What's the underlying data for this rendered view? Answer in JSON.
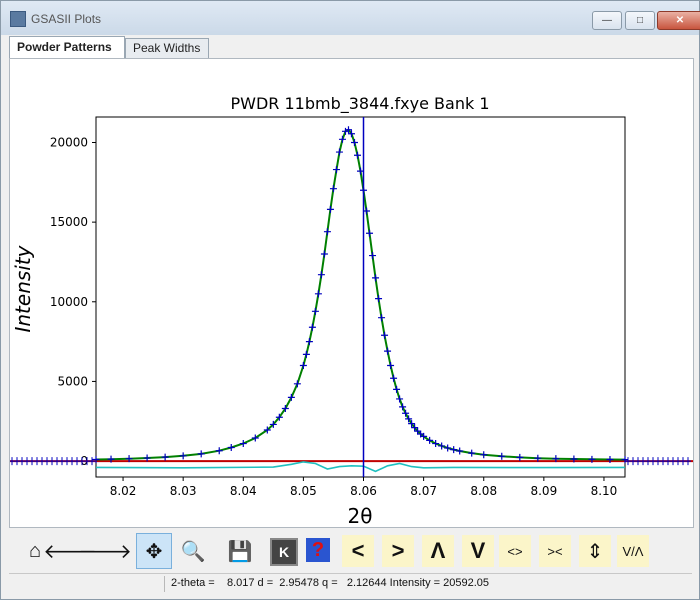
{
  "window": {
    "title": "GSASII Plots",
    "min": "—",
    "max": "□",
    "close": "✕"
  },
  "tabs": [
    {
      "label": "Powder Patterns"
    },
    {
      "label": "Peak Widths"
    }
  ],
  "status": {
    "text": "2-theta =    8.017 d =  2.95478 q =   2.12644 Intensity = 20592.05"
  },
  "toolbar": [
    {
      "name": "home-icon",
      "glyph": "⌂"
    },
    {
      "name": "back-arrow-icon",
      "glyph": "🡐"
    },
    {
      "name": "forward-arrow-icon",
      "glyph": "🡒"
    },
    {
      "name": "pan-icon",
      "glyph": "✥"
    },
    {
      "name": "zoom-icon",
      "glyph": "🔍"
    },
    {
      "name": "save-icon",
      "glyph": "💾"
    },
    {
      "name": "k-key-icon",
      "glyph": "K"
    },
    {
      "name": "help-icon",
      "glyph": "?"
    },
    {
      "name": "shift-left-icon",
      "glyph": "<"
    },
    {
      "name": "shift-right-icon",
      "glyph": ">"
    },
    {
      "name": "shift-up-icon",
      "glyph": "Λ"
    },
    {
      "name": "shift-down-icon",
      "glyph": "V"
    },
    {
      "name": "expand-x-icon",
      "glyph": "<>"
    },
    {
      "name": "contract-x-icon",
      "glyph": "><"
    },
    {
      "name": "expand-y-icon",
      "glyph": "⇕"
    },
    {
      "name": "contract-y-icon",
      "glyph": "V/Λ"
    }
  ],
  "chart_data": {
    "type": "line",
    "title": "PWDR 11bmb_3844.fxye Bank 1",
    "xlabel": "2θ",
    "ylabel": "Intensity",
    "xlim": [
      8.0155,
      8.1035
    ],
    "ylim": [
      -1000,
      21600
    ],
    "xticks": [
      8.02,
      8.03,
      8.04,
      8.05,
      8.06,
      8.07,
      8.08,
      8.09,
      8.1
    ],
    "xtick_labels": [
      "8.02",
      "8.03",
      "8.04",
      "8.05",
      "8.06",
      "8.07",
      "8.08",
      "8.09",
      "8.10"
    ],
    "yticks": [
      0,
      5000,
      10000,
      15000,
      20000
    ],
    "ytick_labels": [
      "0",
      "5000",
      "10000",
      "15000",
      "20000"
    ],
    "peak_position": 8.06,
    "colors": {
      "observed": "#0000c0",
      "calculated": "#008000",
      "difference": "#20c0c0",
      "background": "#c00000",
      "peak_marker": "#0000c0"
    },
    "series": [
      {
        "role": "observed",
        "x": [
          8.0155,
          8.018,
          8.021,
          8.024,
          8.027,
          8.03,
          8.033,
          8.036,
          8.038,
          8.04,
          8.042,
          8.044,
          8.045,
          8.046,
          8.047,
          8.048,
          8.049,
          8.05,
          8.0505,
          8.051,
          8.0515,
          8.052,
          8.0525,
          8.053,
          8.0535,
          8.054,
          8.0545,
          8.055,
          8.0555,
          8.056,
          8.0565,
          8.057,
          8.0575,
          8.058,
          8.0585,
          8.059,
          8.0595,
          8.06,
          8.0605,
          8.061,
          8.0615,
          8.062,
          8.0625,
          8.063,
          8.0635,
          8.064,
          8.0645,
          8.065,
          8.0655,
          8.066,
          8.0665,
          8.067,
          8.0675,
          8.068,
          8.0685,
          8.069,
          8.0695,
          8.07,
          8.071,
          8.072,
          8.073,
          8.074,
          8.075,
          8.076,
          8.078,
          8.08,
          8.083,
          8.086,
          8.089,
          8.092,
          8.095,
          8.098,
          8.101,
          8.1035
        ],
        "y": [
          100,
          120,
          150,
          190,
          250,
          330,
          450,
          650,
          850,
          1100,
          1450,
          1950,
          2300,
          2750,
          3300,
          4000,
          4850,
          6000,
          6700,
          7500,
          8400,
          9400,
          10500,
          11700,
          13000,
          14400,
          15800,
          17100,
          18300,
          19400,
          20200,
          20700,
          20800,
          20550,
          20000,
          19200,
          18200,
          17000,
          15700,
          14300,
          12900,
          11500,
          10200,
          9000,
          7900,
          6900,
          6000,
          5200,
          4500,
          3900,
          3400,
          3000,
          2650,
          2350,
          2100,
          1880,
          1700,
          1550,
          1300,
          1100,
          950,
          820,
          720,
          630,
          500,
          400,
          300,
          230,
          180,
          150,
          130,
          110,
          100,
          90
        ]
      },
      {
        "role": "calculated",
        "x": [
          8.0155,
          8.018,
          8.021,
          8.024,
          8.027,
          8.03,
          8.033,
          8.036,
          8.038,
          8.04,
          8.042,
          8.044,
          8.045,
          8.046,
          8.047,
          8.048,
          8.049,
          8.05,
          8.0505,
          8.051,
          8.0515,
          8.052,
          8.0525,
          8.053,
          8.0535,
          8.054,
          8.0545,
          8.055,
          8.0555,
          8.056,
          8.0565,
          8.057,
          8.0575,
          8.058,
          8.0585,
          8.059,
          8.0595,
          8.06,
          8.0605,
          8.061,
          8.0615,
          8.062,
          8.0625,
          8.063,
          8.0635,
          8.064,
          8.0645,
          8.065,
          8.0655,
          8.066,
          8.0665,
          8.067,
          8.0675,
          8.068,
          8.0685,
          8.069,
          8.0695,
          8.07,
          8.071,
          8.072,
          8.073,
          8.074,
          8.075,
          8.076,
          8.078,
          8.08,
          8.083,
          8.086,
          8.089,
          8.092,
          8.095,
          8.098,
          8.101,
          8.1035
        ],
        "y": [
          100,
          120,
          150,
          190,
          250,
          330,
          450,
          650,
          850,
          1100,
          1450,
          1950,
          2300,
          2750,
          3300,
          4000,
          4850,
          6000,
          6700,
          7500,
          8400,
          9400,
          10500,
          11700,
          13000,
          14400,
          15800,
          17100,
          18300,
          19400,
          20200,
          20700,
          20800,
          20550,
          20000,
          19200,
          18200,
          17000,
          15700,
          14300,
          12900,
          11500,
          10200,
          9000,
          7900,
          6900,
          6000,
          5200,
          4500,
          3900,
          3400,
          3000,
          2650,
          2350,
          2100,
          1880,
          1700,
          1550,
          1300,
          1100,
          950,
          820,
          720,
          630,
          500,
          400,
          300,
          230,
          180,
          150,
          130,
          110,
          100,
          90
        ]
      },
      {
        "role": "difference",
        "x": [
          8.0155,
          8.03,
          8.045,
          8.048,
          8.05,
          8.052,
          8.054,
          8.056,
          8.058,
          8.06,
          8.062,
          8.064,
          8.066,
          8.068,
          8.07,
          8.075,
          8.09,
          8.1035
        ],
        "y": [
          -400,
          -420,
          -380,
          -200,
          -50,
          -150,
          -500,
          -350,
          -300,
          -320,
          -650,
          -300,
          -150,
          -350,
          -420,
          -400,
          -410,
          -400
        ]
      },
      {
        "role": "background",
        "x": [
          8.0155,
          8.1035
        ],
        "y": [
          0,
          0
        ]
      }
    ]
  }
}
